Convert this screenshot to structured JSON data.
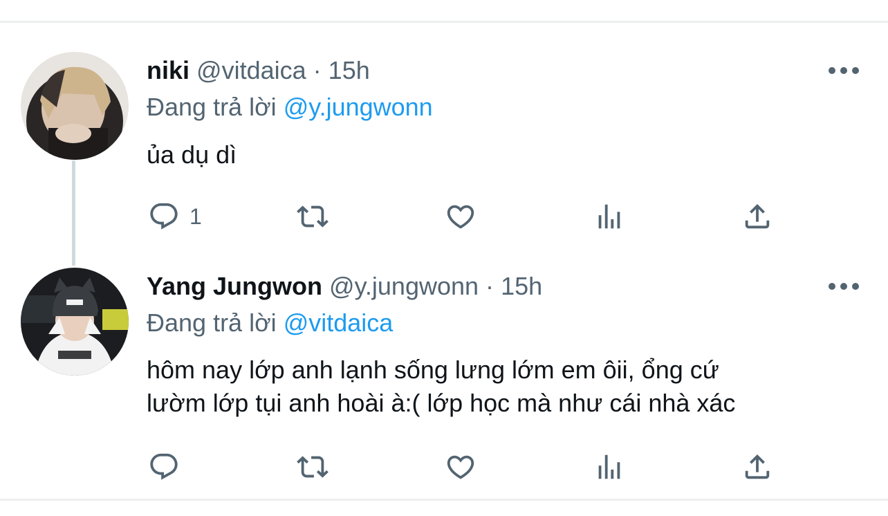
{
  "tweets": [
    {
      "display_name": "niki",
      "handle": "@vitdaica",
      "separator": "·",
      "time": "15h",
      "reply_prefix": "Đang trả lời",
      "reply_to": "@y.jungwonn",
      "text": [
        "ủa dụ dì"
      ],
      "actions": {
        "reply_count": "1",
        "retweet_count": "",
        "like_count": ""
      },
      "icons": [
        "reply-icon",
        "retweet-icon",
        "like-icon",
        "analytics-icon",
        "share-icon",
        "more-icon"
      ]
    },
    {
      "display_name": "Yang Jungwon",
      "handle": "@y.jungwonn",
      "separator": "·",
      "time": "15h",
      "reply_prefix": "Đang trả lời",
      "reply_to": "@vitdaica",
      "text": [
        "hôm nay lớp anh lạnh sống lưng lớm em ôii, ổng cứ",
        "lườm lớp tụi anh hoài à:( lớp học mà như cái nhà xác"
      ],
      "actions": {
        "reply_count": "",
        "retweet_count": "",
        "like_count": ""
      },
      "icons": [
        "reply-icon",
        "retweet-icon",
        "like-icon",
        "analytics-icon",
        "share-icon",
        "more-icon"
      ]
    }
  ],
  "colors": {
    "text_primary": "#0f1419",
    "text_secondary": "#536471",
    "mention": "#1d9bf0",
    "divider": "#eceef0",
    "thread_line": "#cfd9de"
  }
}
